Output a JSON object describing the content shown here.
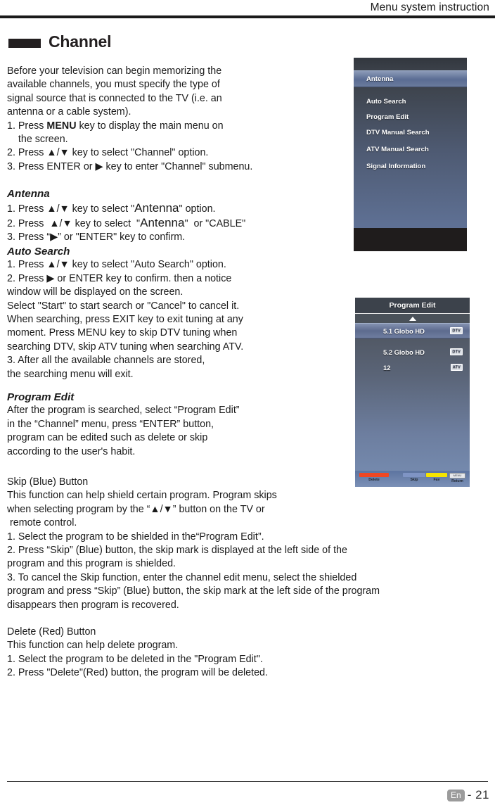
{
  "header": {
    "title": "Menu system instruction"
  },
  "section": {
    "title": "Channel",
    "marker": "black-bar-marker"
  },
  "body": {
    "intro": "Before your television can begin memorizing the\navailable channels, you must specify the type of\nsignal source that is connected to the TV (i.e. an\nantenna or a cable system).",
    "steps_intro": {
      "s1_a": "1. Press ",
      "s1_key": "MENU",
      "s1_b": " key to display the main menu on\n    the screen.",
      "s2": "2. Press ▲/▼ key to select \"Channel\" option.",
      "s3": "3. Press ENTER or ▶ key to enter \"Channel\" submenu."
    },
    "antenna_head": "Antenna",
    "antenna_steps": {
      "s1_a": "1. Press ▲/▼ key to select \"",
      "s1_big": "Antenna",
      "s1_b": "\" option.",
      "s2_a": "2. Press  ▲/▼ key to select  \"",
      "s2_big": "Antenna",
      "s2_b": "\"  or \"CABLE\"",
      "s3": "3. Press “▶” or \"ENTER\" key to confirm."
    },
    "auto_search_head": "Auto Search",
    "auto_search_body": "1. Press ▲/▼ key to select \"Auto Search\" option.\n2. Press ▶ or ENTER key to confirm. then a notice\nwindow will be displayed on the screen.\nSelect \"Start\" to start search or \"Cancel\" to cancel it.\nWhen searching, press EXIT key to exit tuning at any\nmoment. Press MENU key to skip DTV tuning when\nsearching DTV, skip ATV tuning when searching ATV.\n3. After all the available channels are stored,\nthe searching menu will exit.",
    "program_edit_head": "Program Edit",
    "program_edit_body": "After the program is searched, select “Program Edit”\nin the “Channel” menu, press “ENTER” button,\nprogram can be edited such as delete or skip\naccording to the user's habit.",
    "skip_section": "Skip (Blue) Button\nThis function can help shield certain program. Program skips\nwhen selecting program by the “▲/▼” button on the TV or\n remote control.\n1. Select the program to be shielded in the“Program Edit”.\n2. Press “Skip” (Blue) button, the skip mark is displayed at the left side of the\nprogram and this program is shielded.\n3. To cancel the Skip function, enter the channel edit menu, select the shielded\nprogram and press “Skip” (Blue) button, the skip mark at the left side of the program\ndisappears then program is recovered.",
    "delete_section": "Delete (Red) Button\nThis function can help delete program.\n1. Select the program to be deleted in the \"Program Edit\".\n2. Press \"Delete\"(Red) button, the program will be deleted."
  },
  "osd_antenna": {
    "selected_item": "Antenna",
    "items": [
      {
        "label": "Auto Search"
      },
      {
        "label": "Program Edit"
      },
      {
        "label": "DTV Manual Search"
      },
      {
        "label": "ATV Manual Search"
      },
      {
        "label": "Signal Information"
      }
    ],
    "highlight_color": "#6a7b9c"
  },
  "osd_program_edit": {
    "title": "Program Edit",
    "scroll_up_icon": "triangle-up-icon",
    "rows": [
      {
        "name": "5.1 Globo HD",
        "badge": "DTV",
        "selected": true
      },
      {
        "name": "5.2 Globo HD",
        "badge": "DTV",
        "selected": false
      },
      {
        "name": "12",
        "badge": "ATV",
        "selected": false
      }
    ],
    "color_buttons": [
      {
        "label": "Delete",
        "color": "#ef4723"
      },
      {
        "label": "Skip",
        "color": "#7f94c4"
      },
      {
        "label": "Fav",
        "color": "#f5e400"
      },
      {
        "label": "Return",
        "color": "#e6e8ec",
        "key": "MENU"
      }
    ]
  },
  "footer": {
    "language": "En",
    "page": "- 21"
  }
}
